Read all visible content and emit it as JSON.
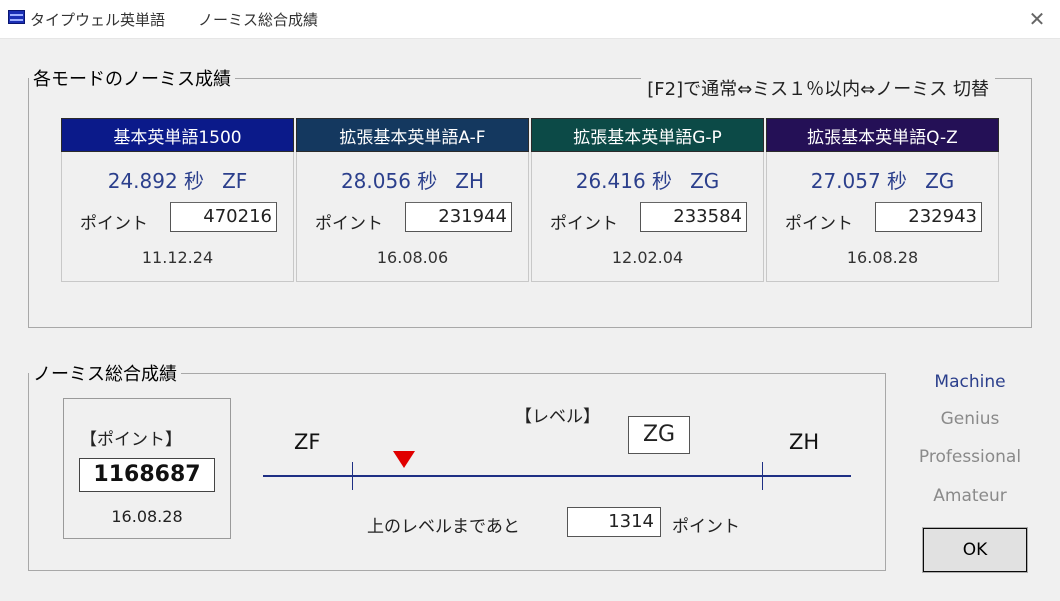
{
  "window": {
    "title": "タイプウェル英単語",
    "subtitle": "ノーミス総合成績",
    "close_glyph": "✕"
  },
  "modes_section": {
    "legend": "各モードのノーミス成績",
    "hint": "[F2]で通常⇔ミス１％以内⇔ノーミス 切替"
  },
  "modes": [
    {
      "name": "基本英単語1500",
      "time": "24.892 秒",
      "level": "ZF",
      "point_label": "ポイント",
      "points": "470216",
      "date": "11.12.24",
      "header_color": "#0b1a8a"
    },
    {
      "name": "拡張基本英単語A-F",
      "time": "28.056 秒",
      "level": "ZH",
      "point_label": "ポイント",
      "points": "231944",
      "date": "16.08.06",
      "header_color": "#14385f"
    },
    {
      "name": "拡張基本英単語G-P",
      "time": "26.416 秒",
      "level": "ZG",
      "point_label": "ポイント",
      "points": "233584",
      "date": "12.02.04",
      "header_color": "#0c4a47"
    },
    {
      "name": "拡張基本英単語Q-Z",
      "time": "27.057 秒",
      "level": "ZG",
      "point_label": "ポイント",
      "points": "232943",
      "date": "16.08.28",
      "header_color": "#241056"
    }
  ],
  "total_section": {
    "legend": "ノーミス総合成績",
    "point_title": "【ポイント】",
    "total_points": "1168687",
    "date": "16.08.28",
    "level_title": "【レベル】",
    "current_level": "ZG",
    "lower_level": "ZF",
    "upper_level": "ZH",
    "marker_progress": 0.25,
    "remaining_label": "上のレベルまであと",
    "remaining_points": "1314",
    "remaining_unit": "ポイント"
  },
  "ranks": {
    "items": [
      "Machine",
      "Genius",
      "Professional",
      "Amateur"
    ],
    "active": "Machine"
  },
  "buttons": {
    "ok_label": "OK"
  }
}
